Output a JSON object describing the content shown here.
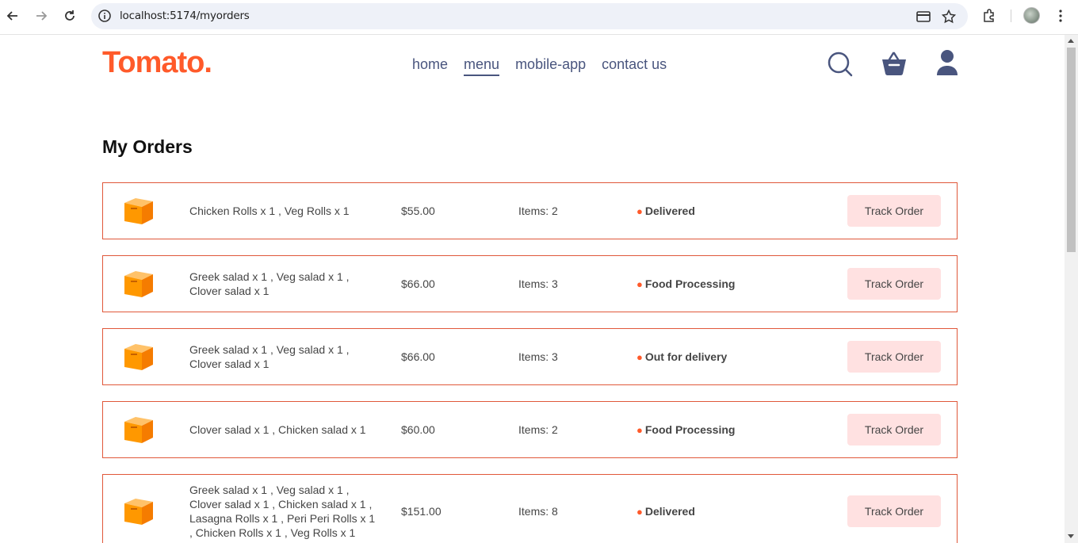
{
  "browser": {
    "url": "localhost:5174/myorders"
  },
  "site": {
    "logo": "Tomato.",
    "nav": [
      {
        "label": "home",
        "active": false
      },
      {
        "label": "menu",
        "active": true
      },
      {
        "label": "mobile-app",
        "active": false
      },
      {
        "label": "contact us",
        "active": false
      }
    ],
    "icons": [
      "search-icon",
      "basket-icon",
      "profile-icon"
    ]
  },
  "page": {
    "title": "My Orders"
  },
  "orders": [
    {
      "items": "Chicken Rolls x 1 , Veg Rolls x 1",
      "amount": "$55.00",
      "count": "Items: 2",
      "status": "Delivered",
      "button": "Track Order"
    },
    {
      "items": "Greek salad x 1 , Veg salad x 1 , Clover salad x 1",
      "amount": "$66.00",
      "count": "Items: 3",
      "status": "Food Processing",
      "button": "Track Order"
    },
    {
      "items": "Greek salad x 1 , Veg salad x 1 , Clover salad x 1",
      "amount": "$66.00",
      "count": "Items: 3",
      "status": "Out for delivery",
      "button": "Track Order"
    },
    {
      "items": "Clover salad x 1 , Chicken salad x 1",
      "amount": "$60.00",
      "count": "Items: 2",
      "status": "Food Processing",
      "button": "Track Order"
    },
    {
      "items": "Greek salad x 1 , Veg salad x 1 , Clover salad x 1 , Chicken salad x 1 , Lasagna Rolls x 1 , Peri Peri Rolls x 1 , Chicken Rolls x 1 , Veg Rolls x 1",
      "amount": "$151.00",
      "count": "Items: 8",
      "status": "Delivered",
      "button": "Track Order"
    }
  ],
  "colors": {
    "brand": "#ff5a2a",
    "border": "#e0583a",
    "button_bg": "#ffe1e1",
    "nav_text": "#49557e"
  }
}
